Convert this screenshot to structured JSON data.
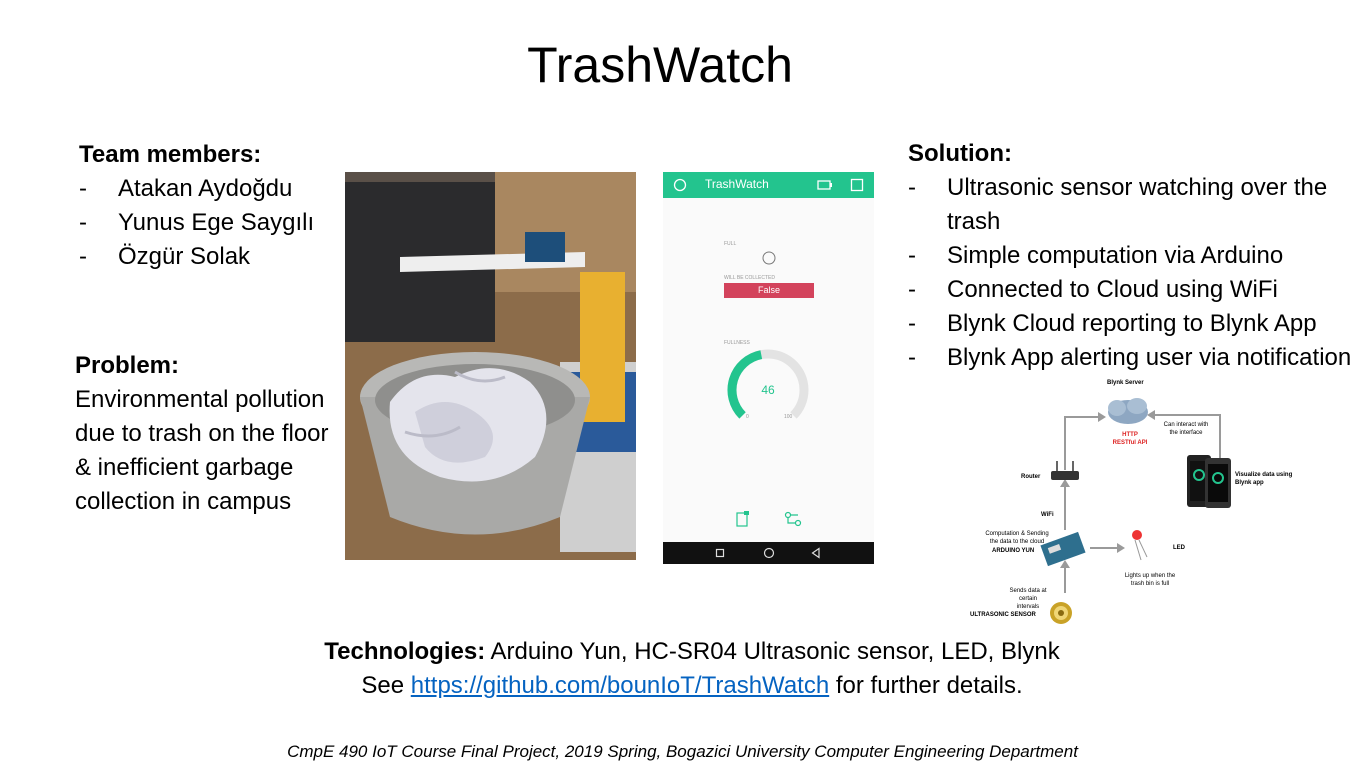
{
  "title": "TrashWatch",
  "team": {
    "heading": "Team members:",
    "members": [
      "Atakan Aydoğdu",
      "Yunus Ege Saygılı",
      "Özgür Solak"
    ]
  },
  "problem": {
    "heading": "Problem:",
    "text": "Environmental pollution due to trash on the floor & inefficient garbage collection in campus"
  },
  "solution": {
    "heading": "Solution:",
    "items": [
      "Ultrasonic sensor watching over the trash",
      "Simple computation via Arduino",
      "Connected to Cloud using WiFi",
      "Blynk Cloud reporting to Blynk App",
      "Blynk App alerting user via notification"
    ]
  },
  "app": {
    "title": "TrashWatch",
    "full_label": "FULL",
    "collected_label": "WILL BE COLLECTED",
    "collected_value": "False",
    "fullness_label": "FULLNESS",
    "gauge_value": "46",
    "gauge_min": "0",
    "gauge_max": "100",
    "gauge_fraction": 0.46,
    "accent": "#23c48e",
    "false_color": "#d3435c"
  },
  "diagram": {
    "blynk_server": "Blynk Server",
    "api": "HTTP RESTful API",
    "interact": "Can interact with the interface",
    "visualize": "Visualize data using Blynk app",
    "router": "Router",
    "wifi": "WiFi",
    "computation": "Computation & Sending the data to the cloud",
    "arduino": "ARDUINO YUN",
    "led": "LED",
    "led_note": "Lights up when the trash bin is full",
    "sends": "Sends data at certain intervals",
    "sensor": "ULTRASONIC SENSOR"
  },
  "tech": {
    "heading": "Technologies:",
    "list": "Arduino Yun, HC-SR04 Ultrasonic sensor, LED, Blynk",
    "see": "See",
    "link": "https://github.com/bounIoT/TrashWatch",
    "after": "for further details."
  },
  "footer": "CmpE 490 IoT Course Final Project, 2019 Spring, Bogazici University Computer Engineering Department"
}
